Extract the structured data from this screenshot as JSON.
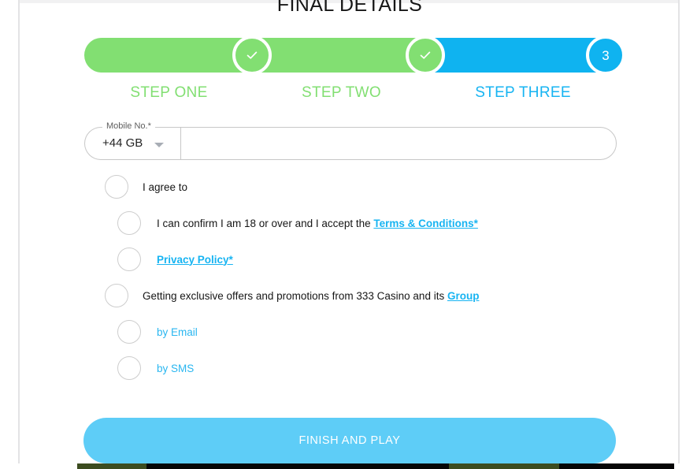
{
  "page": {
    "title": "FINAL DETAILS"
  },
  "stepper": {
    "steps": [
      {
        "label": "STEP ONE",
        "state": "complete",
        "icon": "check-icon",
        "marker": "",
        "color": "#82df72"
      },
      {
        "label": "STEP TWO",
        "state": "complete",
        "icon": "check-icon",
        "marker": "",
        "color": "#82df72"
      },
      {
        "label": "STEP THREE",
        "state": "current",
        "icon": "",
        "marker": "3",
        "color": "#0fb3f0"
      }
    ]
  },
  "mobile_field": {
    "label": "Mobile No.*",
    "country_code_value": "+44 GB",
    "dropdown_icon": "chevron-down-icon",
    "phone_value": "",
    "phone_placeholder": ""
  },
  "consents": {
    "agree": {
      "text": "I agree to",
      "checked": false
    },
    "age_terms": {
      "text_before": "I can confirm I am 18 or over and I accept the ",
      "link_text": "Terms & Conditions*",
      "checked": false
    },
    "privacy": {
      "link_text": "Privacy Policy*",
      "checked": false
    },
    "offers": {
      "text_before": "Getting exclusive offers and promotions from 333 Casino and its ",
      "link_text": "Group",
      "checked": false
    },
    "by_email": {
      "text": "by Email",
      "checked": false
    },
    "by_sms": {
      "text": "by SMS",
      "checked": false
    }
  },
  "submit": {
    "label": "FINISH AND PLAY"
  },
  "colors": {
    "green": "#82df72",
    "blue": "#0fb3f0",
    "link_blue": "#17b4f2",
    "button_blue": "#5ecdf7",
    "text_dark": "#161616",
    "border_grey": "#c7c7c7"
  }
}
